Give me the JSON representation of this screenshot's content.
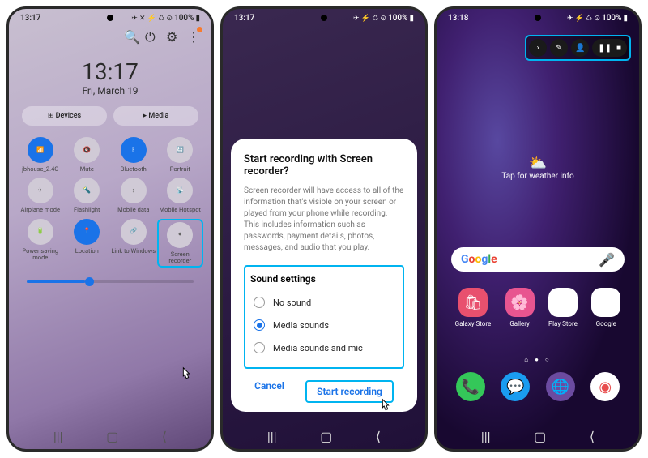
{
  "p1": {
    "status": {
      "time": "13:17",
      "right": "100%"
    },
    "clock": {
      "time": "13:17",
      "date": "Fri, March 19"
    },
    "buttons": {
      "devices": "Devices",
      "media": "Media"
    },
    "tiles": [
      {
        "label": "jbhouse_2.4G",
        "on": true
      },
      {
        "label": "Mute"
      },
      {
        "label": "Bluetooth",
        "on": true
      },
      {
        "label": "Portrait"
      },
      {
        "label": "Airplane mode"
      },
      {
        "label": "Flashlight"
      },
      {
        "label": "Mobile data"
      },
      {
        "label": "Mobile Hotspot"
      },
      {
        "label": "Power saving mode"
      },
      {
        "label": "Location",
        "on": true
      },
      {
        "label": "Link to Windows"
      },
      {
        "label": "Screen recorder"
      }
    ]
  },
  "p2": {
    "status": {
      "time": "13:17",
      "right": "100%"
    },
    "dialog": {
      "title": "Start recording with Screen recorder?",
      "body": "Screen recorder will have access to all of the information that's visible on your screen or played from your phone while recording. This includes information such as passwords, payment details, photos, messages, and audio that you play.",
      "sound_title": "Sound settings",
      "opts": [
        "No sound",
        "Media sounds",
        "Media sounds and mic"
      ],
      "selected": 1,
      "cancel": "Cancel",
      "start": "Start recording"
    }
  },
  "p3": {
    "status": {
      "time": "13:18",
      "right": "100%"
    },
    "weather": "Tap for weather info",
    "apps": [
      "Galaxy Store",
      "Gallery",
      "Play Store",
      "Google"
    ]
  }
}
